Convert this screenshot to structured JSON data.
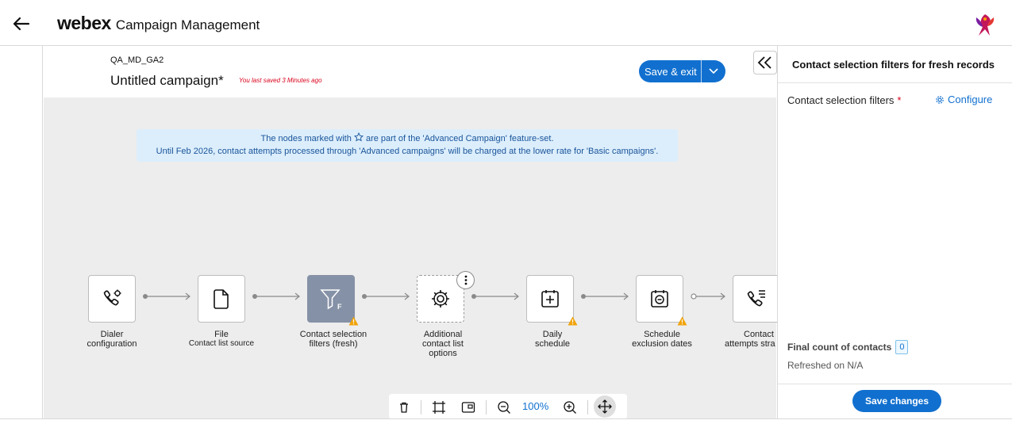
{
  "header": {
    "brand_logo": "webex",
    "brand_app": "Campaign Management"
  },
  "campaign": {
    "project": "QA_MD_GA2",
    "name": "Untitled campaign*",
    "last_saved": "You last saved 3 Minutes ago",
    "save_exit_label": "Save & exit"
  },
  "banner": {
    "line1_prefix": "The nodes marked with",
    "line1_suffix": "are part of the 'Advanced Campaign' feature-set.",
    "line2": "Until Feb 2026, contact attempts processed through 'Advanced campaigns' will be charged at the lower rate for 'Basic campaigns'."
  },
  "nodes": [
    {
      "id": "dialer",
      "line1": "Dialer",
      "line2": "configuration",
      "icon": "phone-gear-icon",
      "warning": false
    },
    {
      "id": "file",
      "line1": "File",
      "line2": "Contact list source",
      "icon": "file-icon",
      "warning": false
    },
    {
      "id": "filters",
      "line1": "Contact selection",
      "line2": "filters (fresh)",
      "icon": "filter-icon",
      "icon_letter": "F",
      "warning": true
    },
    {
      "id": "additional",
      "line1": "Additional",
      "line2": "contact list",
      "line3": "options",
      "icon": "gear-icon",
      "warning": false
    },
    {
      "id": "daily",
      "line1": "Daily",
      "line2": "schedule",
      "icon": "calendar-plus-icon",
      "warning": true
    },
    {
      "id": "exclusion",
      "line1": "Schedule",
      "line2": "exclusion dates",
      "icon": "calendar-minus-icon",
      "warning": true
    },
    {
      "id": "attempts",
      "line1": "Contact",
      "line2": "attempts stra",
      "icon": "phone-list-icon",
      "warning": true
    }
  ],
  "toolbar": {
    "zoom": "100%"
  },
  "panel": {
    "title": "Contact selection filters for fresh records",
    "field_label": "Contact selection filters",
    "required_mark": "*",
    "configure_label": "Configure",
    "final_count_label": "Final count of contacts",
    "final_count_value": "0",
    "refreshed": "Refreshed on N/A",
    "save_changes_label": "Save changes"
  },
  "colors": {
    "accent": "#1170cf",
    "warning": "#f0a30a",
    "danger": "#d8001b",
    "active_node": "#8591a6",
    "canvas_bg": "#ededed",
    "banner_bg": "#dceefc"
  }
}
